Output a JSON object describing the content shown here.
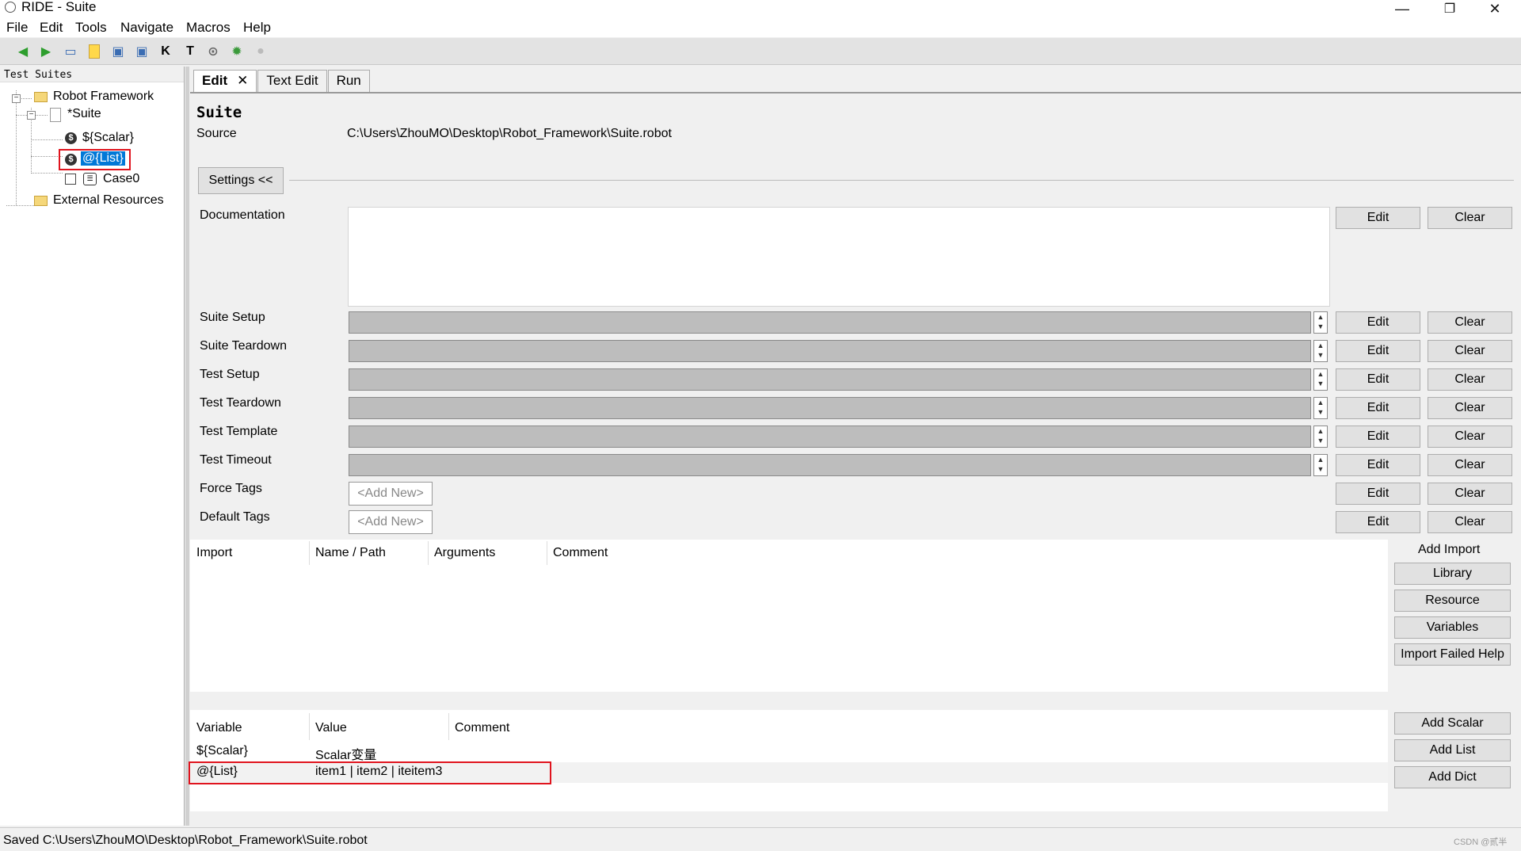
{
  "window": {
    "title": "RIDE - Suite",
    "minimize": "—",
    "maximize": "❐",
    "close": "✕"
  },
  "menu": {
    "file": "File",
    "edit": "Edit",
    "tools": "Tools",
    "navigate": "Navigate",
    "macros": "Macros",
    "help": "Help"
  },
  "toolbar": {
    "icons": [
      "back-arrow-icon",
      "forward-arrow-icon",
      "open-folder-icon",
      "new-file-icon",
      "save-icon",
      "save-all-icon",
      "keyword-search-icon",
      "text-search-icon",
      "run-icon",
      "debug-bug-icon",
      "stop-icon"
    ]
  },
  "tree": {
    "header": "Test Suites",
    "root": "Robot Framework",
    "suite": "*Suite",
    "scalar": "${Scalar}",
    "list": "@{List}",
    "case": "Case0",
    "external": "External Resources"
  },
  "tabs": {
    "edit": "Edit",
    "close": "✕",
    "text_edit": "Text Edit",
    "run": "Run"
  },
  "suite": {
    "title": "Suite",
    "source_label": "Source",
    "source_value": "C:\\Users\\ZhouMO\\Desktop\\Robot_Framework\\Suite.robot",
    "settings_button": "Settings <<"
  },
  "settings": {
    "documentation": "Documentation",
    "suite_setup": "Suite Setup",
    "suite_teardown": "Suite Teardown",
    "test_setup": "Test Setup",
    "test_teardown": "Test Teardown",
    "test_template": "Test Template",
    "test_timeout": "Test Timeout",
    "force_tags": "Force Tags",
    "default_tags": "Default Tags",
    "add_new": "<Add New>",
    "edit": "Edit",
    "clear": "Clear"
  },
  "imports": {
    "headers": [
      "Import",
      "Name / Path",
      "Arguments",
      "Comment"
    ],
    "add_import": "Add Import",
    "library": "Library",
    "resource": "Resource",
    "variables": "Variables",
    "import_failed_help": "Import Failed Help"
  },
  "variables": {
    "headers": [
      "Variable",
      "Value",
      "Comment"
    ],
    "rows": [
      {
        "name": "${Scalar}",
        "value": "Scalar变量"
      },
      {
        "name": "@{List}",
        "value": "item1 | item2 | iteitem3"
      }
    ],
    "add_scalar": "Add Scalar",
    "add_list": "Add List",
    "add_dict": "Add Dict"
  },
  "status": {
    "text": "Saved C:\\Users\\ZhouMO\\Desktop\\Robot_Framework\\Suite.robot",
    "watermark": "CSDN @贰半"
  },
  "colors": {
    "selection": "#0078d7",
    "highlight_box": "#e0141e"
  }
}
